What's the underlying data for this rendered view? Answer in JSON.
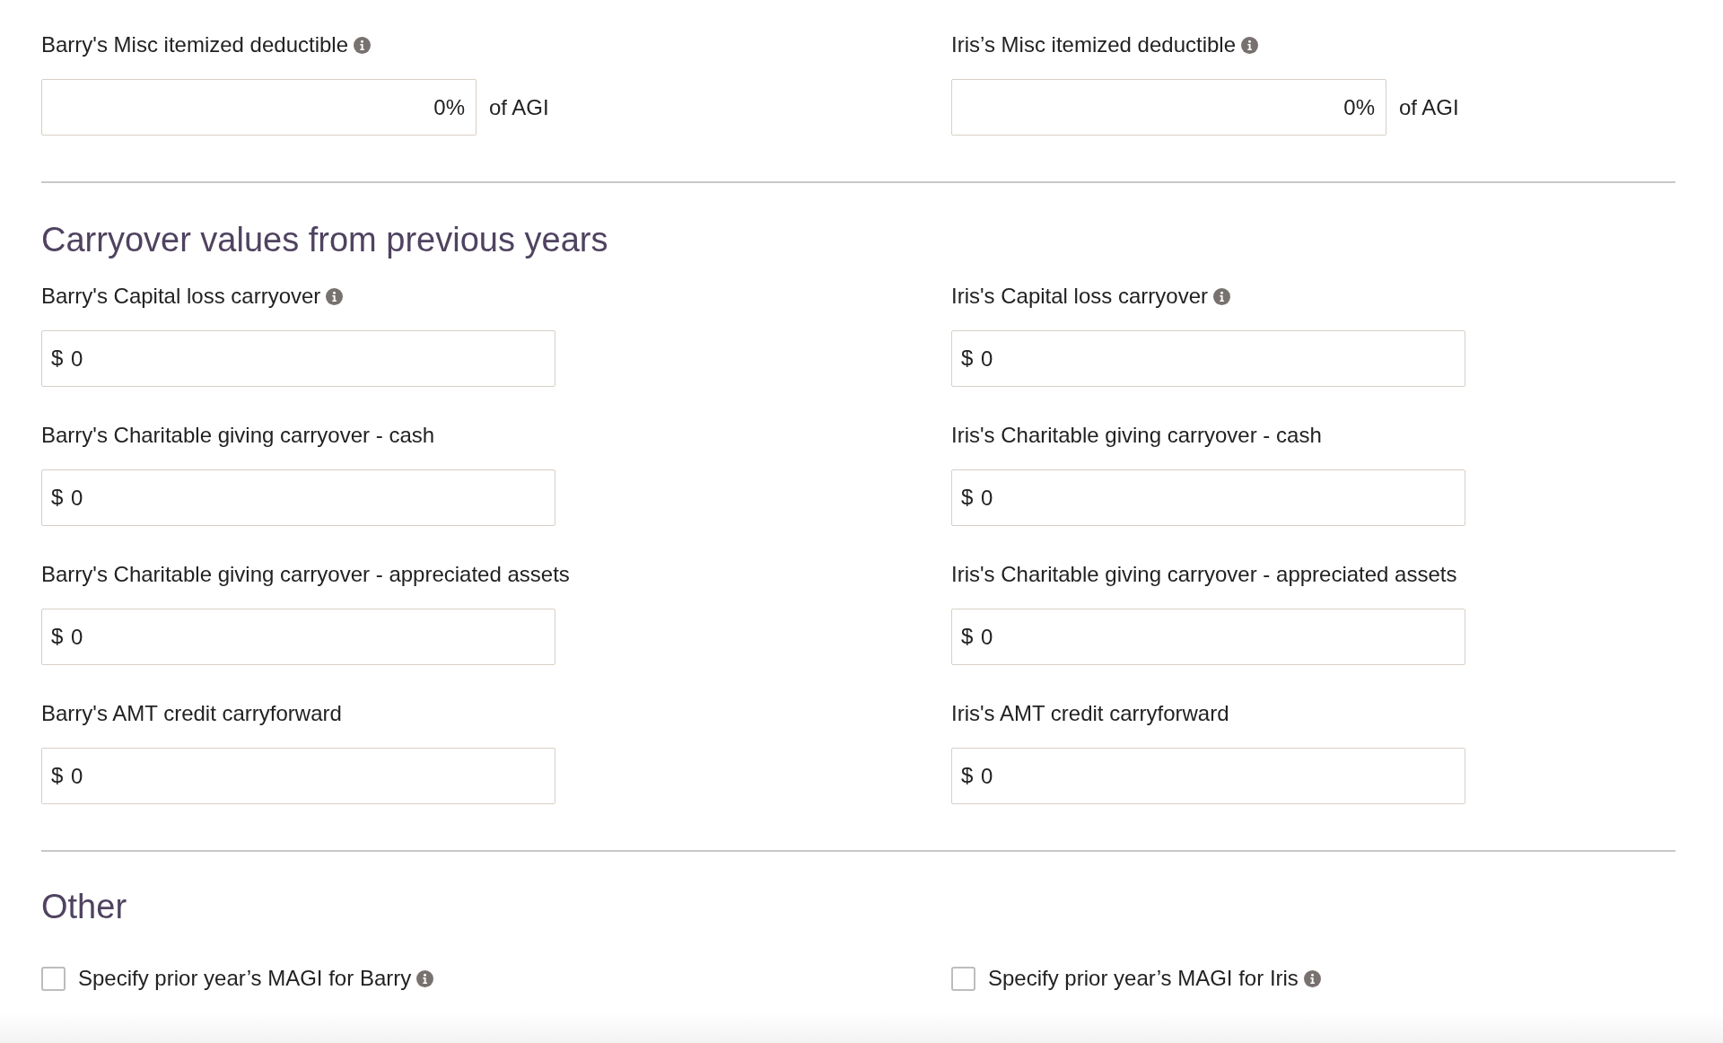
{
  "misc_deductible": [
    {
      "label": "Barry's Misc itemized deductible",
      "info": true,
      "value": "0%",
      "suffix": "of AGI"
    },
    {
      "label": "Iris’s Misc itemized deductible",
      "info": true,
      "value": "0%",
      "suffix": "of AGI"
    }
  ],
  "carryover": {
    "heading": "Carryover values from previous years",
    "fields": [
      {
        "label": "Barry's Capital loss carryover",
        "info": true,
        "prefix": "$",
        "value": "0"
      },
      {
        "label": "Iris's Capital loss carryover",
        "info": true,
        "prefix": "$",
        "value": "0"
      },
      {
        "label": "Barry's Charitable giving carryover - cash",
        "info": false,
        "prefix": "$",
        "value": "0"
      },
      {
        "label": "Iris's Charitable giving carryover - cash",
        "info": false,
        "prefix": "$",
        "value": "0"
      },
      {
        "label": "Barry's Charitable giving carryover - appreciated assets",
        "info": false,
        "prefix": "$",
        "value": "0"
      },
      {
        "label": "Iris's Charitable giving carryover - appreciated assets",
        "info": false,
        "prefix": "$",
        "value": "0"
      },
      {
        "label": "Barry's AMT credit carryforward",
        "info": false,
        "prefix": "$",
        "value": "0"
      },
      {
        "label": "Iris's AMT credit carryforward",
        "info": false,
        "prefix": "$",
        "value": "0"
      }
    ]
  },
  "other": {
    "heading": "Other",
    "options": [
      {
        "label": "Specify prior year’s MAGI for Barry",
        "checked": false,
        "info": true
      },
      {
        "label": "Specify prior year’s MAGI for Iris",
        "checked": false,
        "info": true
      }
    ]
  }
}
